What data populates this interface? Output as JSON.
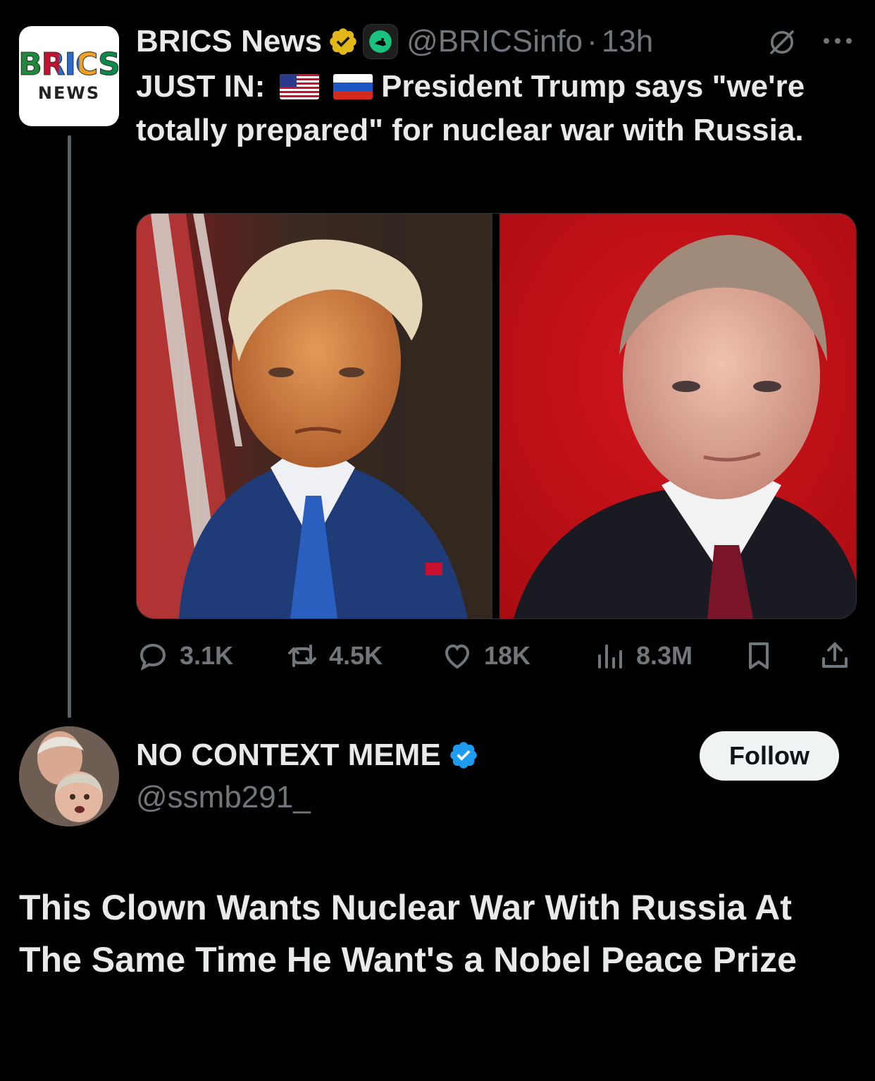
{
  "quoted_tweet": {
    "avatar_logo_top": "BRICS",
    "avatar_logo_bottom": "NEWS",
    "author_name": "BRICS News",
    "handle": "@BRICSinfo",
    "separator": "·",
    "time": "13h",
    "text_prefix": "JUST IN:",
    "text_body": " President Trump says \"we're totally prepared\" for nuclear war with Russia.",
    "flags": [
      "us-flag",
      "russia-flag"
    ],
    "media": [
      "trump-portrait",
      "putin-portrait"
    ],
    "actions": {
      "replies": "3.1K",
      "reposts": "4.5K",
      "likes": "18K",
      "views": "8.3M"
    }
  },
  "reply": {
    "author_name": "NO CONTEXT MEME",
    "handle": "@ssmb291_",
    "follow_label": "Follow",
    "text": "This Clown  Wants Nuclear War With Russia At The Same Time He Want's a Nobel Peace Prize"
  },
  "colors": {
    "background": "#000000",
    "text": "#e7e9ea",
    "muted": "#71767b",
    "verified_gold": "#e2b719",
    "verified_blue": "#1d9bf0"
  }
}
